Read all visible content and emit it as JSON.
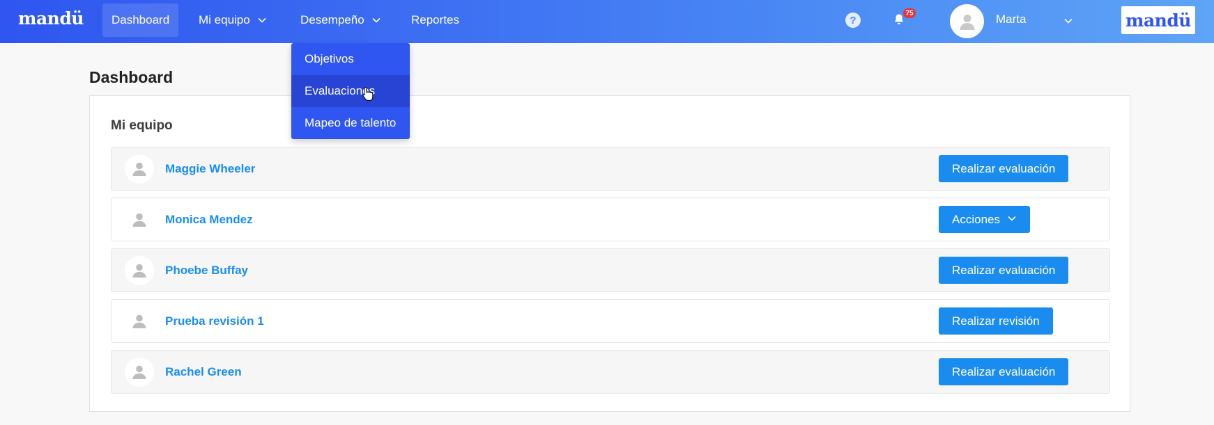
{
  "brand": "mandü",
  "logo_text": "mandü",
  "nav": {
    "dashboard": "Dashboard",
    "mi_equipo": "Mi equipo",
    "desempeno": "Desempeño",
    "reportes": "Reportes"
  },
  "help_glyph": "?",
  "notifications": {
    "count": "75"
  },
  "user": {
    "name": "Marta"
  },
  "dropdown": {
    "items": [
      {
        "label": "Objetivos"
      },
      {
        "label": "Evaluaciones"
      },
      {
        "label": "Mapeo de talento"
      }
    ]
  },
  "page_title": "Dashboard",
  "panel": {
    "title": "Mi equipo",
    "members": [
      {
        "name": "Maggie Wheeler",
        "action": "Realizar evaluación"
      },
      {
        "name": "Monica Mendez",
        "action": "Acciones"
      },
      {
        "name": "Phoebe Buffay",
        "action": "Realizar evaluación"
      },
      {
        "name": "Prueba revisión 1",
        "action": "Realizar revisión"
      },
      {
        "name": "Rachel Green",
        "action": "Realizar evaluación"
      }
    ]
  },
  "colors": {
    "nav_gradient_start": "#2f56f0",
    "nav_gradient_end": "#5ea4f7",
    "accent_blue": "#1a8cf0",
    "badge_red": "#e8343b"
  },
  "icons": [
    "chevron-down-icon",
    "help-icon",
    "bell-icon",
    "user-avatar-icon",
    "hand-cursor-icon"
  ]
}
